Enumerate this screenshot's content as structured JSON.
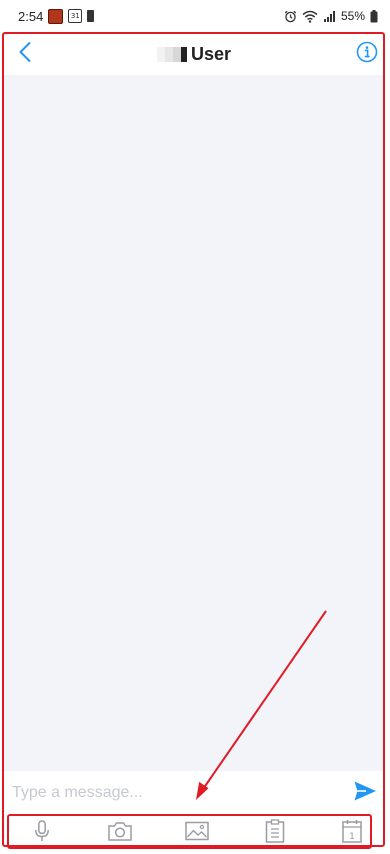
{
  "status_bar": {
    "time": "2:54",
    "calendar_day": "31",
    "battery_percent": "55%",
    "icons": [
      "game-notification-icon",
      "calendar-notification-icon",
      "battery-saver-icon",
      "alarm-icon",
      "wifi-icon",
      "signal-icon",
      "battery-icon"
    ]
  },
  "header": {
    "title": "User",
    "back_icon": "chevron-left-icon",
    "info_icon": "info-icon"
  },
  "composer": {
    "placeholder": "Type a message...",
    "value": "",
    "send_icon": "send-icon"
  },
  "toolbar": {
    "items": [
      {
        "name": "microphone",
        "icon": "microphone-icon"
      },
      {
        "name": "camera",
        "icon": "camera-icon"
      },
      {
        "name": "gallery",
        "icon": "image-icon"
      },
      {
        "name": "clipboard",
        "icon": "clipboard-icon"
      },
      {
        "name": "calendar",
        "icon": "calendar-icon",
        "text": "1"
      }
    ]
  },
  "colors": {
    "accent": "#2196f3",
    "chat_background": "#f3f4f9",
    "toolbar_icon": "#9a9ca3",
    "annotation": "#e01b24"
  }
}
